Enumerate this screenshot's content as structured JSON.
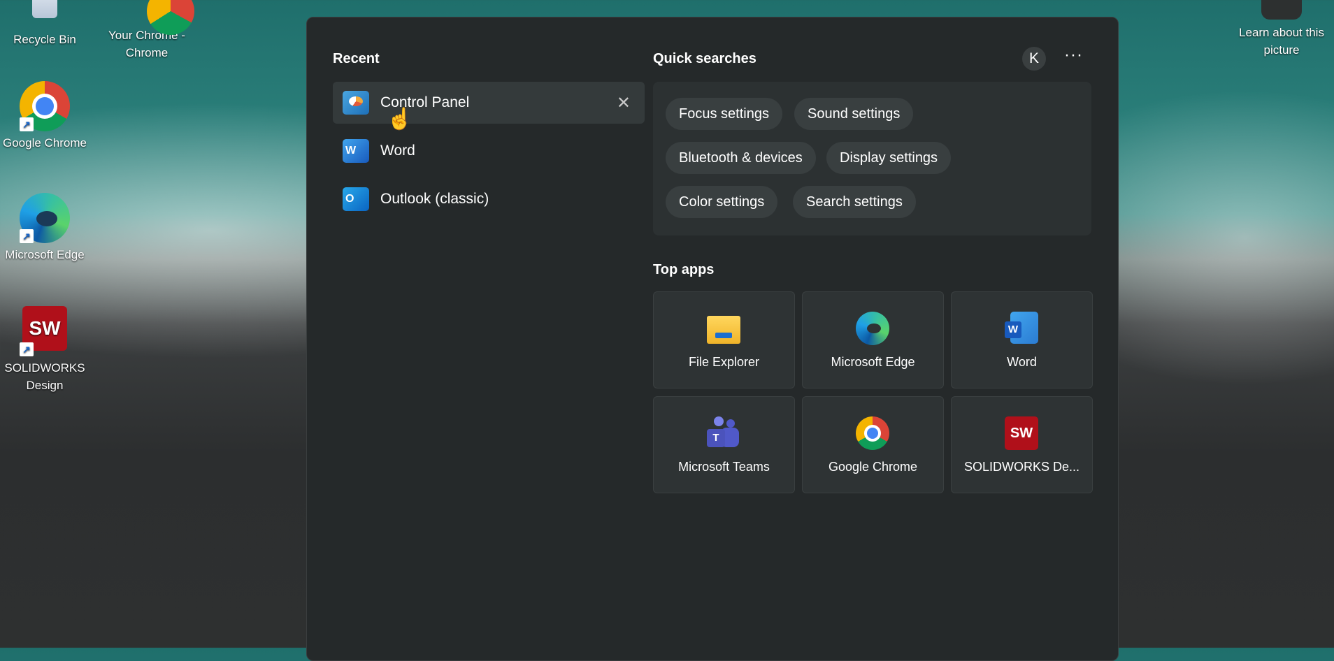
{
  "desktop": {
    "icons": [
      {
        "label": "Recycle Bin"
      },
      {
        "label": "Your Chrome - Chrome"
      },
      {
        "label": "Google Chrome"
      },
      {
        "label": "Microsoft Edge"
      },
      {
        "label": "SOLIDWORKS Design"
      }
    ],
    "learn_label": "Learn about this picture"
  },
  "start": {
    "recent_title": "Recent",
    "recent": [
      {
        "label": "Control Panel",
        "close": "✕"
      },
      {
        "label": "Word"
      },
      {
        "label": "Outlook (classic)"
      }
    ],
    "quick_title": "Quick searches",
    "avatar": "K",
    "more": "···",
    "quick": [
      "Focus settings",
      "Sound settings",
      "Bluetooth & devices",
      "Display settings",
      "Color settings",
      "Search settings"
    ],
    "top_apps_title": "Top apps",
    "top_apps": [
      {
        "label": "File Explorer",
        "icon": "folder-icon"
      },
      {
        "label": "Microsoft Edge",
        "icon": "edge-icon"
      },
      {
        "label": "Word",
        "icon": "word-icon"
      },
      {
        "label": "Microsoft Teams",
        "icon": "teams-icon"
      },
      {
        "label": "Google Chrome",
        "icon": "chrome-icon"
      },
      {
        "label": "SOLIDWORKS De...",
        "icon": "solidworks-icon"
      }
    ]
  },
  "colors": {
    "panel": "#25292a",
    "chip": "#393f40",
    "tile": "#2e3334"
  }
}
